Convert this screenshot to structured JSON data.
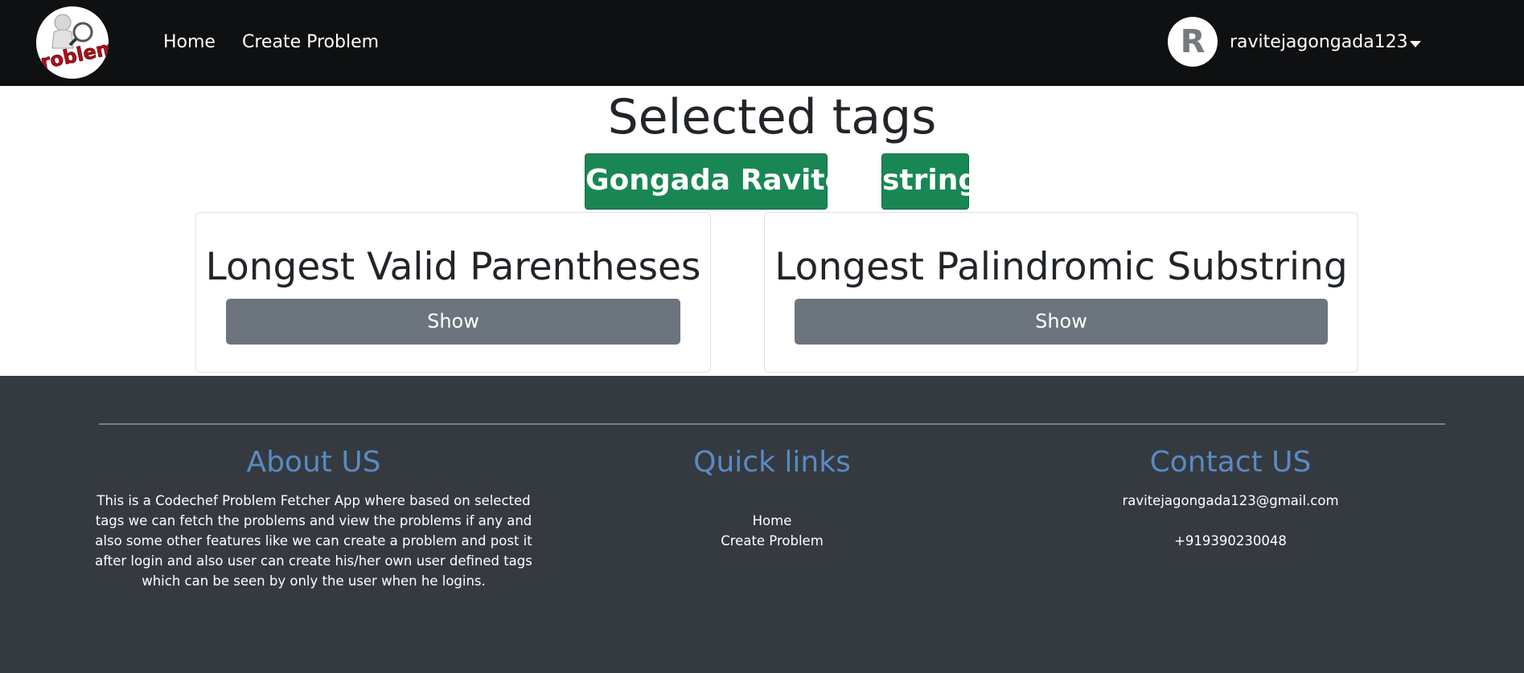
{
  "navbar": {
    "logo_text": "Problem",
    "links": [
      {
        "label": "Home"
      },
      {
        "label": "Create Problem"
      }
    ],
    "user": {
      "avatar_letter": "R",
      "username": "ravitejagongada123"
    }
  },
  "main": {
    "title": "Selected tags",
    "tags": [
      "Gongada Raviteja",
      "string"
    ],
    "problems": [
      {
        "title": "Longest Valid Parentheses",
        "button_label": "Show"
      },
      {
        "title": "Longest Palindromic Substring",
        "button_label": "Show"
      }
    ]
  },
  "footer": {
    "about": {
      "heading": "About US",
      "text": "This is a Codechef Problem Fetcher App where based on selected tags we can fetch the problems and view the problems if any and also some other features like we can create a problem and post it after login and also user can create his/her own user defined tags which can be seen by only the user when he logins."
    },
    "quick_links": {
      "heading": "Quick links",
      "links": [
        "Home",
        "Create Problem"
      ]
    },
    "contact": {
      "heading": "Contact US",
      "email": "ravitejagongada123@gmail.com",
      "phone": "+919390230048"
    }
  },
  "colors": {
    "navbar_bg": "#0e1012",
    "tag_bg": "#198754",
    "button_bg": "#6c757d",
    "footer_bg": "#343a40",
    "footer_heading": "#5a8ac2"
  }
}
